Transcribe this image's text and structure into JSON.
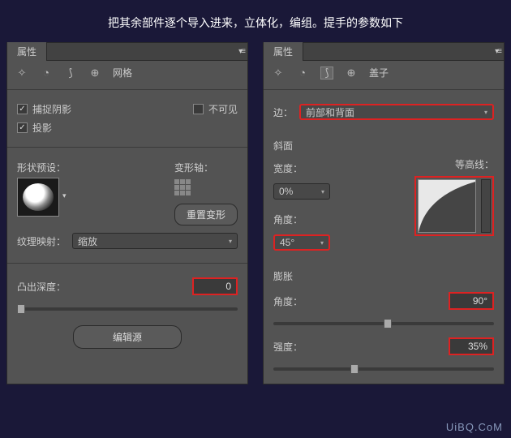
{
  "caption": "把其余部件逐个导入进来，立体化，编组。提手的参数如下",
  "left": {
    "panel_title": "属性",
    "icon_label": "网格",
    "catch_shadow": "捕捉阴影",
    "invisible": "不可见",
    "cast_shadow": "投影",
    "shape_preset": "形状预设：",
    "deform_axis": "变形轴：",
    "reset_deform": "重置变形",
    "texture_map": "纹理映射：",
    "texture_value": "缩放",
    "extrude_depth": "凸出深度：",
    "extrude_value": "0",
    "edit_source": "编辑源"
  },
  "right": {
    "panel_title": "属性",
    "icon_label": "盖子",
    "edge": "边：",
    "edge_value": "前部和背面",
    "bevel": "斜面",
    "width": "宽度：",
    "width_value": "0%",
    "contour": "等高线：",
    "angle": "角度：",
    "angle_value": "45°",
    "inflate": "膨胀",
    "inflate_angle": "角度：",
    "inflate_angle_value": "90°",
    "strength": "强度：",
    "strength_value": "35%"
  },
  "watermark": "UiBQ.CoM"
}
